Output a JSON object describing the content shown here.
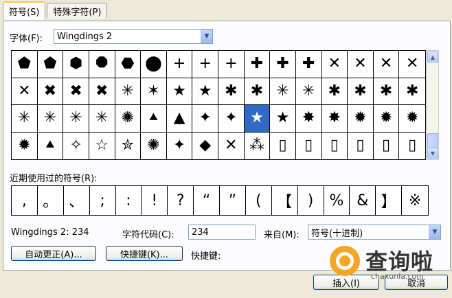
{
  "tabs": [
    {
      "label": "符号(S)"
    },
    {
      "label": "特殊字符(P)"
    }
  ],
  "font": {
    "label": "字体(F):",
    "value": "Wingdings 2"
  },
  "symbols": [
    "⬟",
    "⬟",
    "⬢",
    "⯃",
    "⬣",
    "⬤",
    "+",
    "+",
    "+",
    "✚",
    "✚",
    "✚",
    "✕",
    "✕",
    "✕",
    "✕",
    "✕",
    "✖",
    "✖",
    "✖",
    "✳",
    "✶",
    "★",
    "★",
    "✱",
    "✱",
    "✳",
    "✳",
    "✱",
    "✱",
    "✱",
    "✱",
    "✳",
    "✳",
    "✳",
    "✳",
    "✺",
    "⯅",
    "▲",
    "✦",
    "✦",
    "★",
    "★",
    "✸",
    "✸",
    "✹",
    "✹",
    "✹",
    "✹",
    "⯅",
    "✧",
    "☆",
    "✮",
    "✺",
    "✦",
    "◆",
    "✕",
    "⁂",
    "▯",
    "▯",
    "▯",
    "▯",
    "▯",
    "▯"
  ],
  "recent": {
    "label": "近期使用过的符号(R):",
    "items": [
      ",",
      "。",
      "、",
      ";",
      ":",
      "!",
      "?",
      "“",
      "”",
      "(",
      "【",
      ")",
      "%",
      "&",
      "】",
      "※"
    ]
  },
  "info": {
    "name": "Wingdings 2: 234"
  },
  "code": {
    "label": "字符代码(C):",
    "value": "234"
  },
  "from": {
    "label": "来自(M):",
    "value": "符号(十进制)"
  },
  "buttons": {
    "autocorrect": "自动更正(A)...",
    "shortcut": "快捷键(K)...",
    "shortcut_label": "快捷键:",
    "insert": "插入(I)",
    "cancel": "取消"
  },
  "watermark": {
    "text": "查询啦",
    "sub": "chaxunla.com"
  },
  "colors": {
    "selected": "#316AC5",
    "logo": "#F5A623"
  }
}
